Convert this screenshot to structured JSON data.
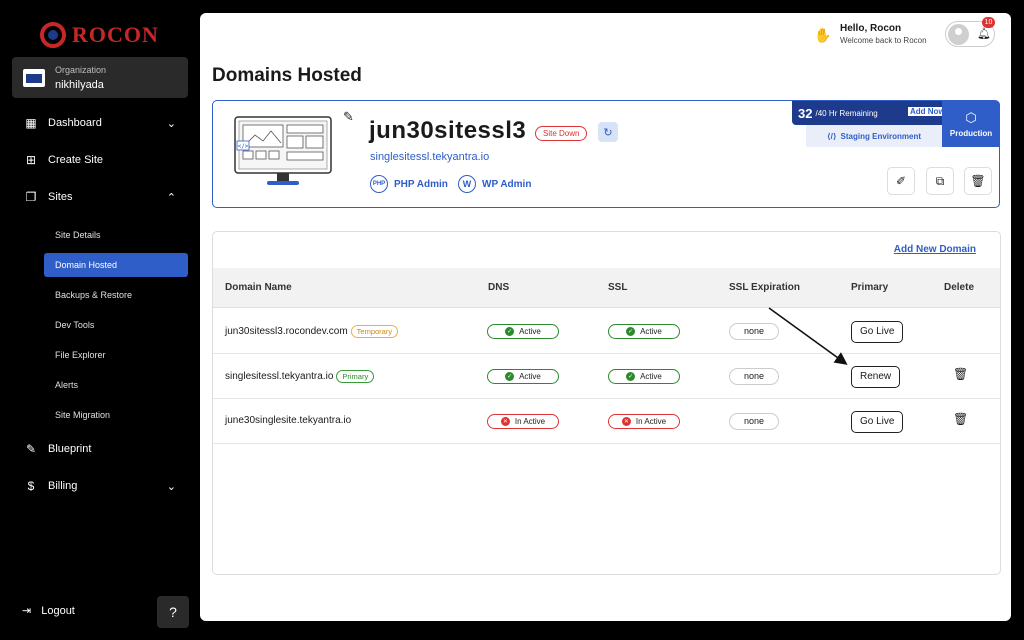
{
  "brand": {
    "name": "ROCON"
  },
  "organization": {
    "label": "Organization",
    "name": "nikhilyada"
  },
  "nav": {
    "dashboard": "Dashboard",
    "create_site": "Create Site",
    "sites": "Sites",
    "sub_items": [
      "Site Details",
      "Domain Hosted",
      "Backups & Restore",
      "Dev Tools",
      "File Explorer",
      "Alerts",
      "Site Migration"
    ],
    "blueprint": "Blueprint",
    "billing": "Billing",
    "logout": "Logout"
  },
  "header": {
    "greeting": "Hello, Rocon",
    "subtitle": "Welcome back to Rocon",
    "notifications": "10"
  },
  "page": {
    "title": "Domains Hosted"
  },
  "site": {
    "name": "jun30sitessl3",
    "status": "Site Down",
    "url": "singlesitessl.tekyantra.io",
    "php_admin": "PHP Admin",
    "php_icon_text": "PHP",
    "wp_admin": "WP Admin",
    "hours_used": "32",
    "hours_total": "/40 Hr Remaining",
    "add_now": "Add Now",
    "staging": "Staging Environment",
    "production": "Production"
  },
  "domains": {
    "add_label": "Add New Domain",
    "columns": [
      "Domain Name",
      "DNS",
      "SSL",
      "SSL Expiration",
      "Primary",
      "Delete"
    ],
    "rows": [
      {
        "domain": "jun30sitessl3.rocondev.com",
        "tag": "Temporary",
        "dns": "Active",
        "ssl": "Active",
        "expiration": "none",
        "primary": "Go Live"
      },
      {
        "domain": "singlesitessl.tekyantra.io",
        "tag": "Primary",
        "dns": "Active",
        "ssl": "Active",
        "expiration": "none",
        "primary": "Renew"
      },
      {
        "domain": "june30singlesite.tekyantra.io",
        "tag": "",
        "dns": "In Active",
        "ssl": "In Active",
        "expiration": "none",
        "primary": "Go Live"
      }
    ]
  },
  "colors": {
    "accent": "#2f5ec9",
    "navy": "#1e3a8a",
    "danger": "#dd3333",
    "success": "#2c8a2c",
    "warning": "#e8b04a"
  }
}
